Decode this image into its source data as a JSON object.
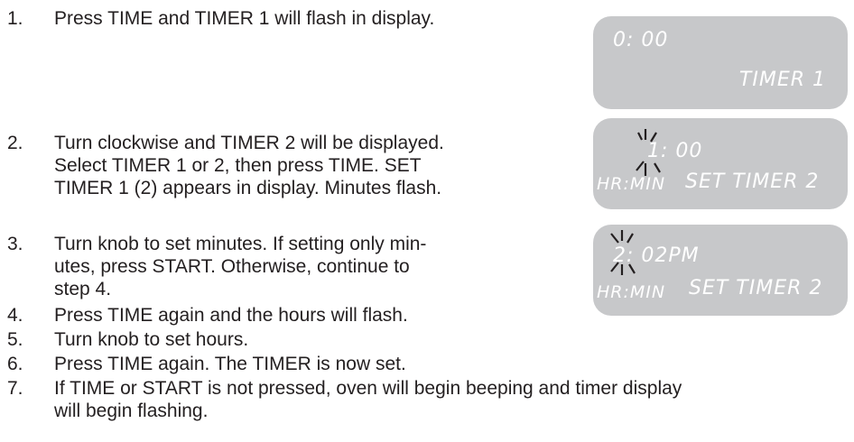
{
  "steps": [
    {
      "num": "1.",
      "lines": [
        "Press TIME and TIMER 1 will flash in display."
      ]
    },
    {
      "num": "2.",
      "lines": [
        "Turn clockwise and TIMER 2 will be displayed.",
        "Select TIMER 1 or 2, then press TIME. SET",
        "TIMER 1 (2) appears in display. Minutes flash."
      ]
    },
    {
      "num": "3.",
      "lines": [
        "Turn knob to set minutes. If setting only min-",
        "utes, press START. Otherwise, continue to",
        "step 4."
      ]
    },
    {
      "num": "4.",
      "lines": [
        "Press TIME again and the hours will flash."
      ]
    },
    {
      "num": "5.",
      "lines": [
        "Turn knob to set hours."
      ]
    },
    {
      "num": "6.",
      "lines": [
        "Press TIME again. The TIMER is now set."
      ]
    },
    {
      "num": "7.",
      "lines": [
        "If TIME or START is not pressed, oven will begin beeping and timer display",
        "will begin flashing."
      ]
    }
  ],
  "displays": [
    {
      "time": "0: 00",
      "label": "TIMER 1"
    },
    {
      "time": "1: 00",
      "unit": "HR:MIN",
      "label": "SET TIMER 2"
    },
    {
      "time": "2: 02PM",
      "unit": "HR:MIN",
      "label": "SET TIMER 2"
    }
  ],
  "colors": {
    "text": "#231f20",
    "panel": "#c7c8ca",
    "lcd_text": "#ffffff"
  }
}
